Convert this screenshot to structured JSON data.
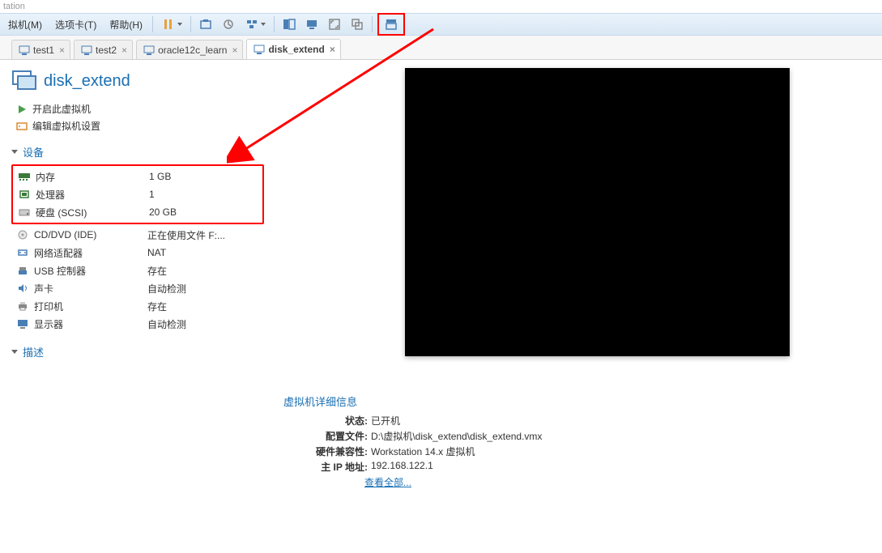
{
  "app_title": "tation",
  "menu": {
    "vm": "拟机(M)",
    "tabs": "选项卡(T)",
    "help": "帮助(H)"
  },
  "tabs": [
    {
      "label": "test1"
    },
    {
      "label": "test2"
    },
    {
      "label": "oracle12c_learn"
    },
    {
      "label": "disk_extend",
      "active": true
    }
  ],
  "vm_name": "disk_extend",
  "actions": {
    "power_on": "开启此虚拟机",
    "edit": "编辑虚拟机设置"
  },
  "sections": {
    "devices": "设备",
    "description": "描述",
    "details": "虚拟机详细信息"
  },
  "devices": [
    {
      "name": "内存",
      "value": "1 GB",
      "icon": "memory"
    },
    {
      "name": "处理器",
      "value": "1",
      "icon": "cpu"
    },
    {
      "name": "硬盘 (SCSI)",
      "value": "20 GB",
      "icon": "disk"
    },
    {
      "name": "CD/DVD (IDE)",
      "value": "正在使用文件 F:...",
      "icon": "cd"
    },
    {
      "name": "网络适配器",
      "value": "NAT",
      "icon": "net"
    },
    {
      "name": "USB 控制器",
      "value": "存在",
      "icon": "usb"
    },
    {
      "name": "声卡",
      "value": "自动检测",
      "icon": "sound"
    },
    {
      "name": "打印机",
      "value": "存在",
      "icon": "printer"
    },
    {
      "name": "显示器",
      "value": "自动检测",
      "icon": "display"
    }
  ],
  "details": {
    "status_k": "状态:",
    "status_v": "已开机",
    "config_k": "配置文件:",
    "config_v": "D:\\虚拟机\\disk_extend\\disk_extend.vmx",
    "compat_k": "硬件兼容性:",
    "compat_v": "Workstation 14.x 虚拟机",
    "ip_k": "主 IP 地址:",
    "ip_v": "192.168.122.1",
    "more": "查看全部..."
  }
}
